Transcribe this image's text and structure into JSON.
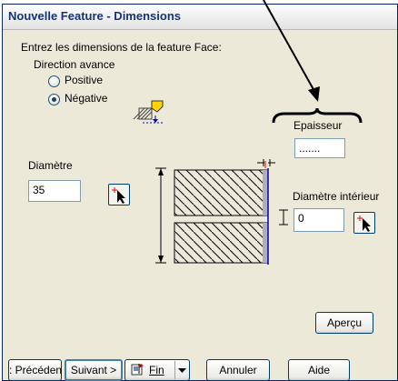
{
  "window": {
    "title": "Nouvelle Feature - Dimensions"
  },
  "instructions": "Entrez les dimensions de la feature Face:",
  "direction": {
    "label": "Direction avance",
    "options": [
      {
        "label": "Positive",
        "selected": false
      },
      {
        "label": "Négative",
        "selected": true
      }
    ]
  },
  "fields": {
    "diametre": {
      "label": "Diamètre",
      "value": "35"
    },
    "epaisseur": {
      "label": "Epaisseur",
      "value": "......."
    },
    "diametre_interieur": {
      "label": "Diamètre intérieur",
      "value": "0"
    }
  },
  "buttons": {
    "apercu": "Aperçu",
    "precedent": ": Précéden",
    "suivant": "Suivant >",
    "fin": "Fin",
    "annuler": "Annuler",
    "aide": "Aide"
  },
  "colors": {
    "title": "#15337a",
    "accent": "#ffd700",
    "dimension_line": "#0000cc",
    "marker": "#ff0000"
  }
}
